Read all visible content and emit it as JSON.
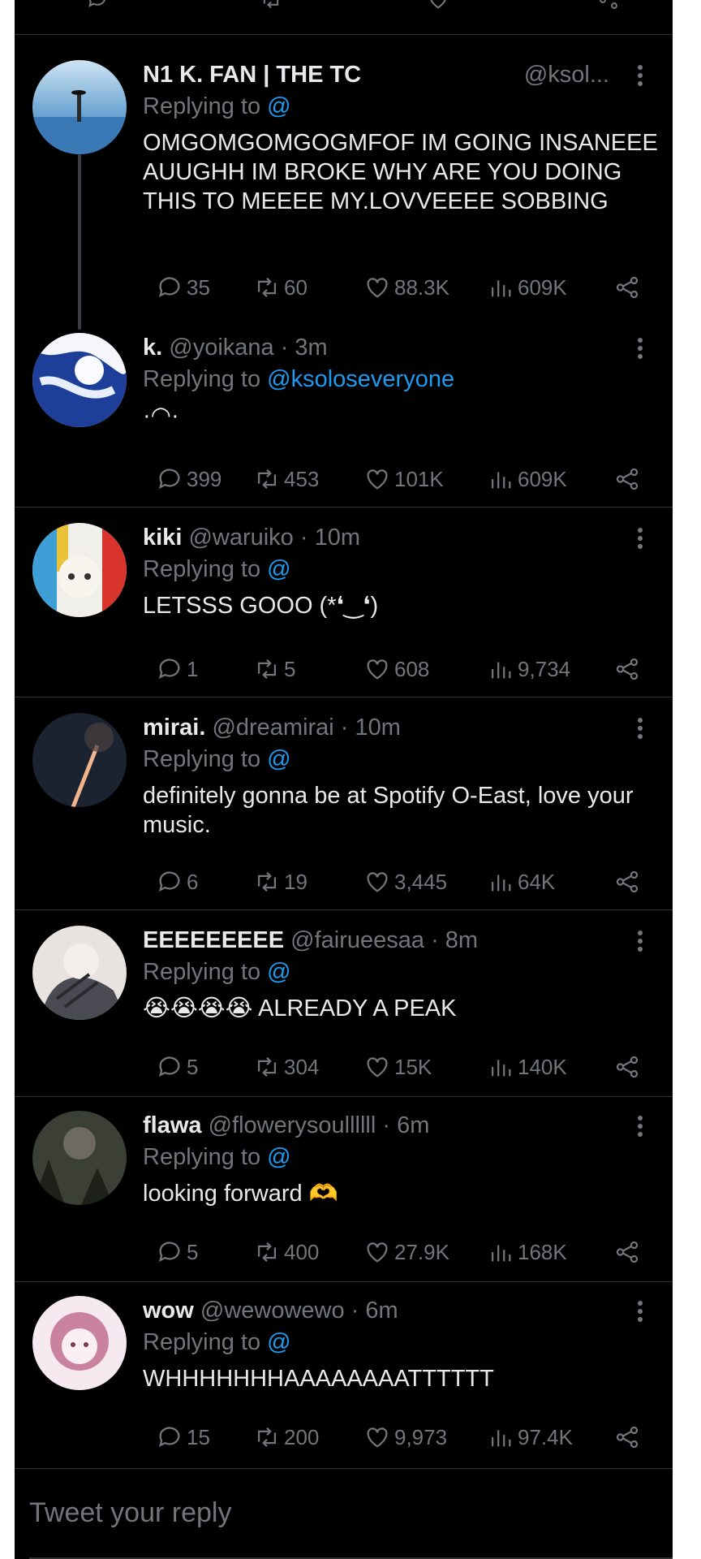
{
  "reply_box": {
    "placeholder": "Tweet your reply"
  },
  "colors": {
    "background": "#000000",
    "text": "#e7e9ea",
    "muted": "#71767b",
    "link": "#1d9bf0",
    "divider": "#2f3336"
  },
  "tweets": [
    {
      "name": "N1 K. FAN | THE TC",
      "handle": "@ksol...",
      "time": "",
      "replying_prefix": "Replying to ",
      "replying_to": "@",
      "text": "OMGOMGOMGOGMFOF IM GOING INSANEEE AUUGHH IM BROKE WHY ARE YOU DOING THIS TO MEEEE MY.LOVVEEEE SOBBING",
      "replies": "35",
      "retweets": "60",
      "likes": "88.3K",
      "views": "609K"
    },
    {
      "name": "k.",
      "handle": "@yoikana",
      "time": " · 3m",
      "replying_prefix": "Replying to ",
      "replying_to": "@ksoloseveryone",
      "text": "·◠·",
      "replies": "399",
      "retweets": "453",
      "likes": "101K",
      "views": "609K"
    },
    {
      "name": "kiki",
      "handle": "@waruiko",
      "time": " · 10m",
      "replying_prefix": "Replying to ",
      "replying_to": "@",
      "text": "LETSSS GOOO (*❛‿❛)",
      "replies": "1",
      "retweets": "5",
      "likes": "608",
      "views": "9,734"
    },
    {
      "name": "mirai.",
      "handle": "@dreamirai",
      "time": " · 10m",
      "replying_prefix": "Replying to ",
      "replying_to": "@",
      "text": "definitely gonna be at Spotify O-East, love your music.",
      "replies": "6",
      "retweets": "19",
      "likes": "3,445",
      "views": "64K"
    },
    {
      "name": "EEEEEEEEE",
      "handle": "@fairueesaa",
      "time": " · 8m",
      "replying_prefix": "Replying to ",
      "replying_to": "@",
      "text": "😭😭😭😭 ALREADY A PEAK",
      "replies": "5",
      "retweets": "304",
      "likes": "15K",
      "views": "140K"
    },
    {
      "name": "flawa",
      "handle": "@flowerysoullllll",
      "time": " · 6m",
      "replying_prefix": "Replying to ",
      "replying_to": "@",
      "text": "looking forward 🫶",
      "replies": "5",
      "retweets": "400",
      "likes": "27.9K",
      "views": "168K"
    },
    {
      "name": "wow",
      "handle": "@wewowewo",
      "time": " · 6m",
      "replying_prefix": "Replying to ",
      "replying_to": "@",
      "text": "WHHHHHHHAAAAAAAATTTTTT",
      "replies": "15",
      "retweets": "200",
      "likes": "9,973",
      "views": "97.4K"
    }
  ]
}
